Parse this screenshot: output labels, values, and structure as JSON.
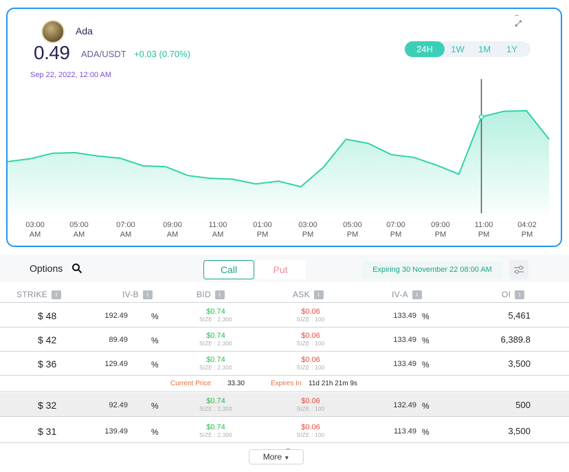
{
  "coin": {
    "name": "Ada",
    "logo_icon": "cardano-logo-icon"
  },
  "price": "0.49",
  "pair": "ADA/USDT",
  "change": "+0.03 (0.70%)",
  "timestamp": "Sep 22, 2022, 12:00 AM",
  "ranges": [
    "24H",
    "1W",
    "1M",
    "1Y"
  ],
  "active_range": "24H",
  "colors": {
    "accent": "#3ccfb7",
    "line": "#2ed3a8",
    "frame": "#2196f3",
    "bid": "#1fbf4a",
    "ask": "#e84a3c"
  },
  "chart_data": {
    "type": "area",
    "x_ticks": [
      [
        "03:00",
        "AM"
      ],
      [
        "05:00",
        "AM"
      ],
      [
        "07:00",
        "AM"
      ],
      [
        "09:00",
        "AM"
      ],
      [
        "11:00",
        "AM"
      ],
      [
        "01:00",
        "PM"
      ],
      [
        "03:00",
        "PM"
      ],
      [
        "05:00",
        "PM"
      ],
      [
        "07:00",
        "PM"
      ],
      [
        "09:00",
        "PM"
      ],
      [
        "11:00",
        "PM"
      ],
      [
        "04:02",
        "PM"
      ]
    ],
    "series": [
      {
        "values": [
          0.448,
          0.449,
          0.451,
          0.4512,
          0.45,
          0.4492,
          0.4465,
          0.4462,
          0.443,
          0.442,
          0.4417,
          0.44,
          0.441,
          0.439,
          0.446,
          0.456,
          0.4545,
          0.4505,
          0.4495,
          0.4468,
          0.4435,
          0.464,
          0.466,
          0.4662,
          0.456
        ]
      }
    ],
    "hover_index": 21,
    "ylim": [
      0.43,
      0.478
    ],
    "grid": false,
    "legend": "none"
  },
  "options": {
    "label": "Options",
    "call_label": "Call",
    "put_label": "Put",
    "expiry": "Expiring 30 November 22 08:00 AM"
  },
  "table": {
    "headers": [
      "STRIKE",
      "IV-B",
      "BID",
      "ASK",
      "IV-A",
      "OI"
    ],
    "info_glyph": "i",
    "pct": "%",
    "rows": [
      {
        "strike": "$ 48",
        "ivb": "192.49",
        "bid": "$0.74",
        "bid_size": "SIZE : 2,300",
        "ask": "$0.06",
        "ask_size": "SIZE : 100",
        "iva": "133.49",
        "oi": "5,461"
      },
      {
        "strike": "$ 42",
        "ivb": "89.49",
        "bid": "$0.74",
        "bid_size": "SIZE : 2,300",
        "ask": "$0.06",
        "ask_size": "SIZE : 100",
        "iva": "133.49",
        "oi": "6,389.8"
      },
      {
        "strike": "$ 36",
        "ivb": "129.49",
        "bid": "$0.74",
        "bid_size": "SIZE : 2,300",
        "ask": "$0.06",
        "ask_size": "SIZE : 100",
        "iva": "133.49",
        "oi": "3,500"
      },
      {
        "strike": "$ 32",
        "ivb": "92.49",
        "bid": "$0.74",
        "bid_size": "SIZE : 2,300",
        "ask": "$0.06",
        "ask_size": "SIZE : 100",
        "iva": "132.49",
        "oi": "500"
      },
      {
        "strike": "$ 31",
        "ivb": "139.49",
        "bid": "$0.74",
        "bid_size": "SIZE : 2,300",
        "ask": "$0.06",
        "ask_size": "SIZE : 100",
        "iva": "113.49",
        "oi": "3,500"
      }
    ],
    "current_price_label": "Current Price",
    "current_price": "33.30",
    "expires_label": "Expires In",
    "expires_value": "11d 21h 21m 9s"
  },
  "more_label": "More"
}
